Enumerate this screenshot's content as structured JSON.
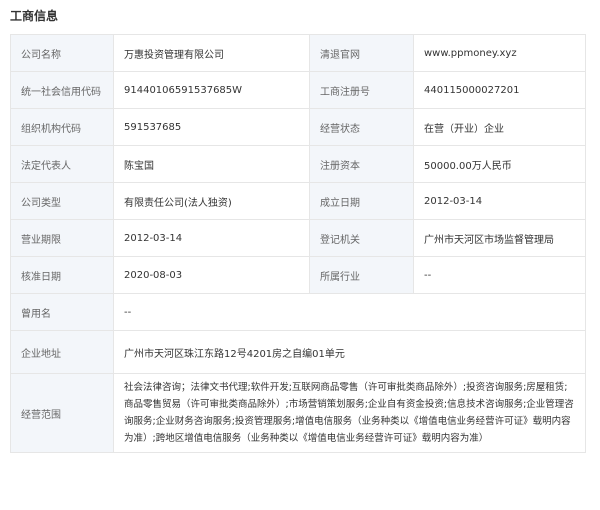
{
  "section": {
    "title": "工商信息"
  },
  "rows": [
    {
      "label1": "公司名称",
      "value1": "万惠投资管理有限公司",
      "label2": "清退官网",
      "value2": "www.ppmoney.xyz"
    },
    {
      "label1": "统一社会信用代码",
      "value1": "91440106591537685W",
      "label2": "工商注册号",
      "value2": "440115000027201"
    },
    {
      "label1": "组织机构代码",
      "value1": "591537685",
      "label2": "经营状态",
      "value2": "在营（开业）企业"
    },
    {
      "label1": "法定代表人",
      "value1": "陈宝国",
      "label2": "注册资本",
      "value2": "50000.00万人民币"
    },
    {
      "label1": "公司类型",
      "value1": "有限责任公司(法人独资)",
      "label2": "成立日期",
      "value2": "2012-03-14"
    },
    {
      "label1": "营业期限",
      "value1": "2012-03-14",
      "label2": "登记机关",
      "value2": "广州市天河区市场监督管理局"
    },
    {
      "label1": "核准日期",
      "value1": "2020-08-03",
      "label2": "所属行业",
      "value2": "--"
    }
  ],
  "former_name": {
    "label": "曾用名",
    "value": "--"
  },
  "address": {
    "label": "企业地址",
    "value": "广州市天河区珠江东路12号4201房之自编01单元"
  },
  "scope": {
    "label": "经营范围",
    "value": "社会法律咨询；法律文书代理;软件开发;互联网商品零售（许可审批类商品除外）;投资咨询服务;房屋租赁;商品零售贸易（许可审批类商品除外）;市场营销策划服务;企业自有资金投资;信息技术咨询服务;企业管理咨询服务;企业财务咨询服务;投资管理服务;增值电信服务（业务种类以《增值电信业务经营许可证》载明内容为准）;跨地区增值电信服务（业务种类以《增值电信业务经营许可证》载明内容为准）"
  }
}
